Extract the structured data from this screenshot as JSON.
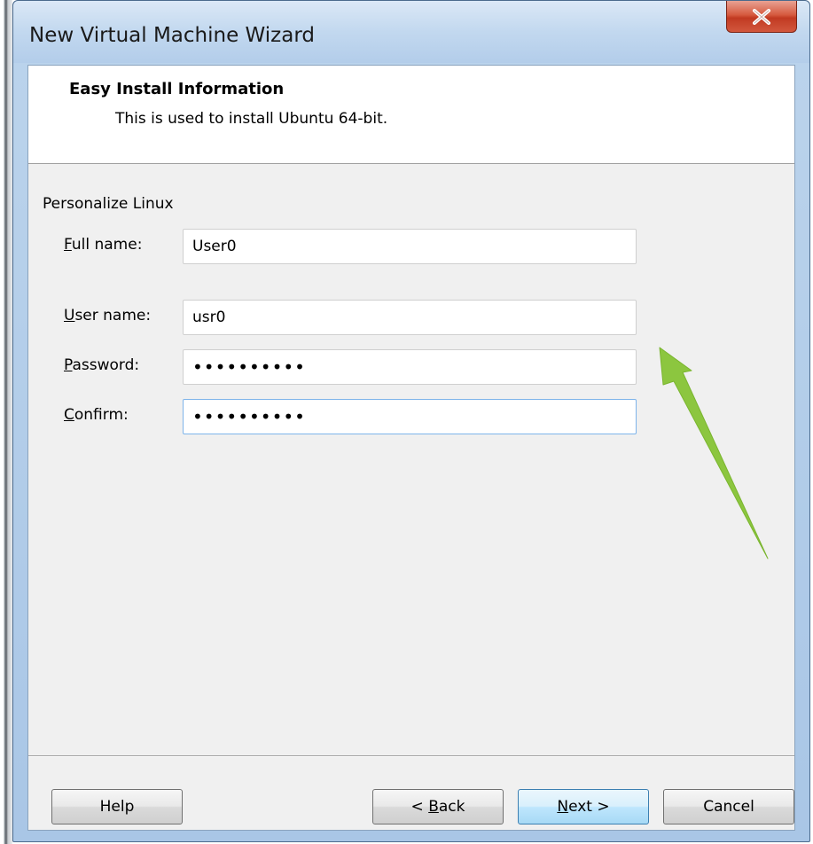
{
  "window": {
    "title": "New Virtual Machine Wizard"
  },
  "header": {
    "title": "Easy Install Information",
    "subtitle": "This is used to install Ubuntu 64-bit."
  },
  "form": {
    "section_label": "Personalize Linux",
    "full_name": {
      "label_hotkey": "F",
      "label_rest": "ull name:",
      "value": "User0"
    },
    "user_name": {
      "label_hotkey": "U",
      "label_rest": "ser name:",
      "value": "usr0"
    },
    "password": {
      "label_hotkey": "P",
      "label_rest": "assword:",
      "value": "••••••••••"
    },
    "confirm": {
      "label_hotkey": "C",
      "label_rest": "onfirm:",
      "value": "••••••••••"
    }
  },
  "buttons": {
    "help": "Help",
    "back_prefix": "< ",
    "back_hotkey": "B",
    "back_rest": "ack",
    "next_hotkey": "N",
    "next_rest": "ext >",
    "cancel": "Cancel"
  },
  "icons": {
    "close": "close-icon",
    "annotation": "green-arrow-icon"
  },
  "colors": {
    "close_button": "#c13a22",
    "arrow": "#8cc63f",
    "focus_border": "#7eb4ea"
  }
}
